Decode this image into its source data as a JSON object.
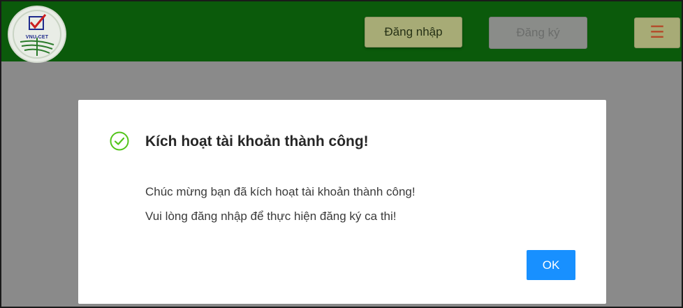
{
  "header": {
    "logo_text": "VNU-CET",
    "login_label": "Đăng nhập",
    "register_label": "Đăng ký",
    "menu_icon": "☰"
  },
  "modal": {
    "title": "Kích hoạt tài khoản thành công!",
    "message_line1": "Chúc mừng bạn đã kích hoạt tài khoản thành công!",
    "message_line2": "Vui lòng đăng nhập để thực hiện đăng ký ca thi!",
    "ok_label": "OK"
  },
  "colors": {
    "header_bg": "#0b5a0b",
    "overlay": "#8a8a8a",
    "success": "#52c41a",
    "primary": "#1890ff",
    "login_button": "#a7ab76"
  }
}
